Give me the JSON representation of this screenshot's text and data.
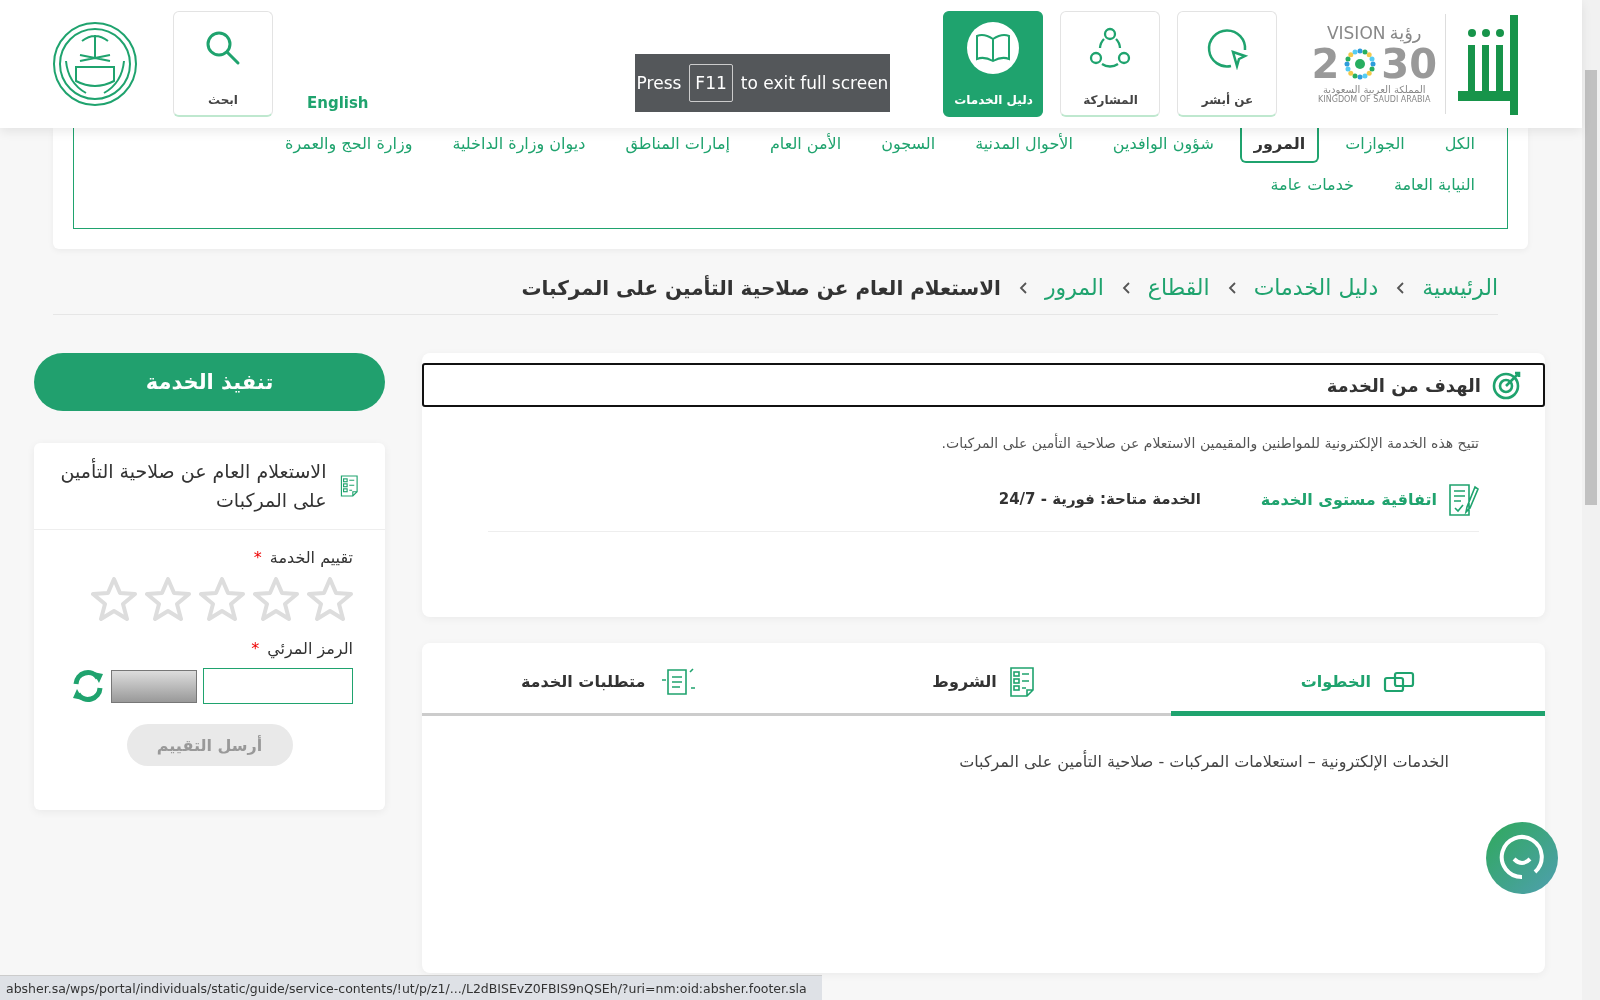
{
  "header": {
    "nav_buttons": [
      {
        "label": "عن أبشر",
        "kind": "about",
        "selected": false
      },
      {
        "label": "المشاركة",
        "kind": "share",
        "selected": false
      },
      {
        "label": "دليل الخدمات",
        "kind": "guide",
        "selected": true
      }
    ],
    "vision_logo": {
      "arabic": "رؤية",
      "title": "VISION",
      "year_start": "2",
      "year_end": "30",
      "subtitle_ar": "المملكة العربية السعودية",
      "subtitle_en": "KINGDOM OF SAUDI ARABIA"
    },
    "language_link": "English",
    "search_button": "ابحث"
  },
  "fullscreen_toast": {
    "before": "Press",
    "key": "F11",
    "after": "to exit full screen"
  },
  "category_rows": [
    [
      {
        "label": "الكل",
        "selected": false
      },
      {
        "label": "الجوازات",
        "selected": false
      },
      {
        "label": "المرور",
        "selected": true
      },
      {
        "label": "شؤون الوافدين",
        "selected": false
      },
      {
        "label": "الأحوال المدنية",
        "selected": false
      },
      {
        "label": "السجون",
        "selected": false
      },
      {
        "label": "الأمن العام",
        "selected": false
      },
      {
        "label": "إمارات المناطق",
        "selected": false
      },
      {
        "label": "ديوان وزارة الداخلية",
        "selected": false
      },
      {
        "label": "وزارة الحج والعمرة",
        "selected": false
      }
    ],
    [
      {
        "label": "النيابة العامة",
        "selected": false
      },
      {
        "label": "خدمات عامة",
        "selected": false
      }
    ]
  ],
  "breadcrumb": [
    "الرئيسية",
    "دليل الخدمات",
    "القطاع",
    "المرور",
    "الاستعلام العام عن صلاحية التأمين على المركبات"
  ],
  "goal": {
    "title": "الهدف من الخدمة",
    "description": "تتيح هذه الخدمة الإلكترونية للمواطنين والمقيمين الاستعلام عن صلاحية التأمين على المركبات.",
    "sla_link": "اتفاقية مستوى الخدمة",
    "availability": "الخدمة متاحة: فورية - 24/7"
  },
  "tabs": [
    {
      "label": "الخطوات",
      "kind": "steps",
      "selected": true
    },
    {
      "label": "الشروط",
      "kind": "terms",
      "selected": false
    },
    {
      "label": "متطلبات الخدمة",
      "kind": "requirements",
      "selected": false
    }
  ],
  "tab_content": "الخدمات الإلكترونية – استعلامات المركبات - صلاحية التأمين على المركبات",
  "sidebar": {
    "execute_button": "تنفيذ الخدمة",
    "service_title": "الاستعلام العام عن صلاحية التأمين على المركبات",
    "rating_label": "تقييم الخدمة",
    "rating_required": "*",
    "stars": 0,
    "captcha_label": "الرمز المرئي",
    "captcha_required": "*",
    "submit_button": {
      "label": "أرسل التقييم",
      "disabled": true
    }
  },
  "status_bar": "absher.sa/wps/portal/individuals/static/guide/service-contents/!ut/p/z1/.../L2dBISEvZ0FBIS9nQSEh/?uri=nm:oid:absher.footer.sla"
}
